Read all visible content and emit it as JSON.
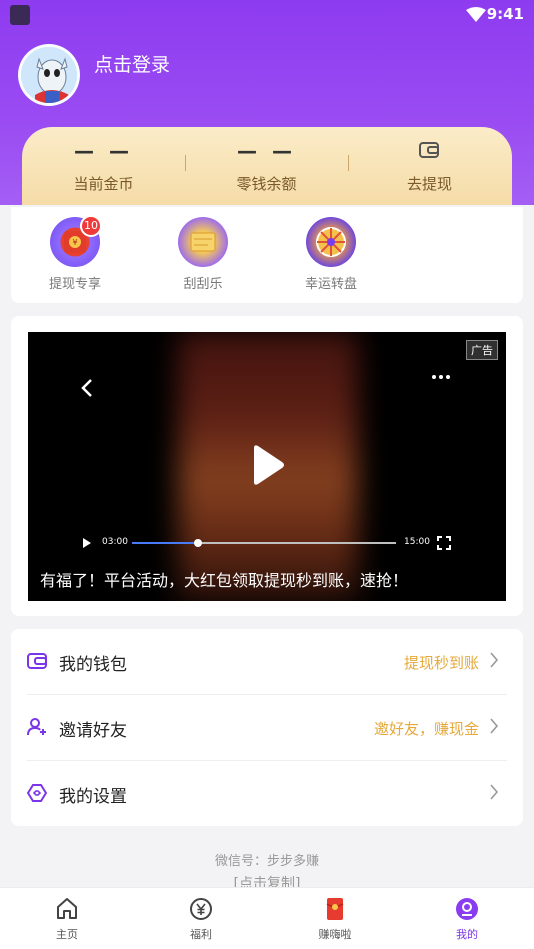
{
  "status": {
    "time": "9:41"
  },
  "profile": {
    "login_text": "点击登录"
  },
  "wallet_bar": {
    "coins_value": "— —",
    "coins_label": "当前金币",
    "balance_value": "— —",
    "balance_label": "零钱余额",
    "withdraw_label": "去提现"
  },
  "entries": [
    {
      "label": "提现专享",
      "badge": "10"
    },
    {
      "label": "刮刮乐"
    },
    {
      "label": "幸运转盘"
    }
  ],
  "video": {
    "ad_tag": "广告",
    "time_current": "03:00",
    "time_total": "15:00",
    "progress": 0.25,
    "caption": "有福了！平台活动，大红包领取提现秒到账，速抢！"
  },
  "menu": [
    {
      "label": "我的钱包",
      "hint": "提现秒到账"
    },
    {
      "label": "邀请好友",
      "hint": "邀好友，赚现金"
    },
    {
      "label": "我的设置",
      "hint": ""
    }
  ],
  "footer": {
    "wechat": "微信号：步步多赚",
    "copy": "[点击复制]"
  },
  "tabs": [
    {
      "label": "主页"
    },
    {
      "label": "福利"
    },
    {
      "label": "赚嗨啦"
    },
    {
      "label": "我的"
    }
  ],
  "colors": {
    "primary": "#8e3bf0",
    "accent_gold": "#e5a93c",
    "active_tab": "#7b35e8"
  }
}
